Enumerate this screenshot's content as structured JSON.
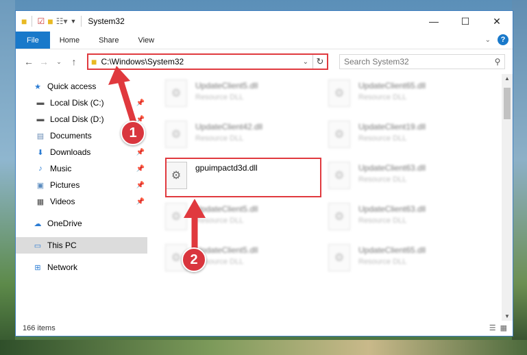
{
  "window": {
    "title": "System32"
  },
  "ribbon": {
    "tabs": [
      "File",
      "Home",
      "Share",
      "View"
    ]
  },
  "address": {
    "path": "C:\\Windows\\System32"
  },
  "search": {
    "placeholder": "Search System32"
  },
  "sidebar": {
    "items": [
      {
        "label": "Quick access",
        "icon": "star-icon"
      },
      {
        "label": "Local Disk (C:)",
        "icon": "drive-icon"
      },
      {
        "label": "Local Disk (D:)",
        "icon": "drive-icon"
      },
      {
        "label": "Documents",
        "icon": "documents-icon"
      },
      {
        "label": "Downloads",
        "icon": "download-icon"
      },
      {
        "label": "Music",
        "icon": "music-icon"
      },
      {
        "label": "Pictures",
        "icon": "pictures-icon"
      },
      {
        "label": "Videos",
        "icon": "videos-icon"
      },
      {
        "label": "OneDrive",
        "icon": "cloud-icon"
      },
      {
        "label": "This PC",
        "icon": "computer-icon"
      },
      {
        "label": "Network",
        "icon": "network-icon"
      }
    ]
  },
  "files": [
    {
      "name": "UpdateClient5.dll",
      "type": "Resource DLL"
    },
    {
      "name": "UpdateClient65.dll",
      "type": "Resource DLL"
    },
    {
      "name": "UpdateClient42.dll",
      "type": "Resource DLL"
    },
    {
      "name": "UpdateClient19.dll",
      "type": "Resource DLL"
    },
    {
      "name": "gpuimpactd3d.dll",
      "type": ""
    },
    {
      "name": "UpdateClient63.dll",
      "type": "Resource DLL"
    },
    {
      "name": "UpdateClient5.dll",
      "type": "Resource DLL"
    },
    {
      "name": "UpdateClient63.dll",
      "type": "Resource DLL"
    },
    {
      "name": "UpdateClient5.dll",
      "type": "Resource DLL"
    },
    {
      "name": "UpdateClient65.dll",
      "type": "Resource DLL"
    }
  ],
  "status": {
    "item_count": "166 items"
  },
  "callouts": {
    "one": "1",
    "two": "2"
  },
  "colors": {
    "accent": "#1979ca",
    "highlight": "#e0393e",
    "callout": "#d9363e"
  }
}
